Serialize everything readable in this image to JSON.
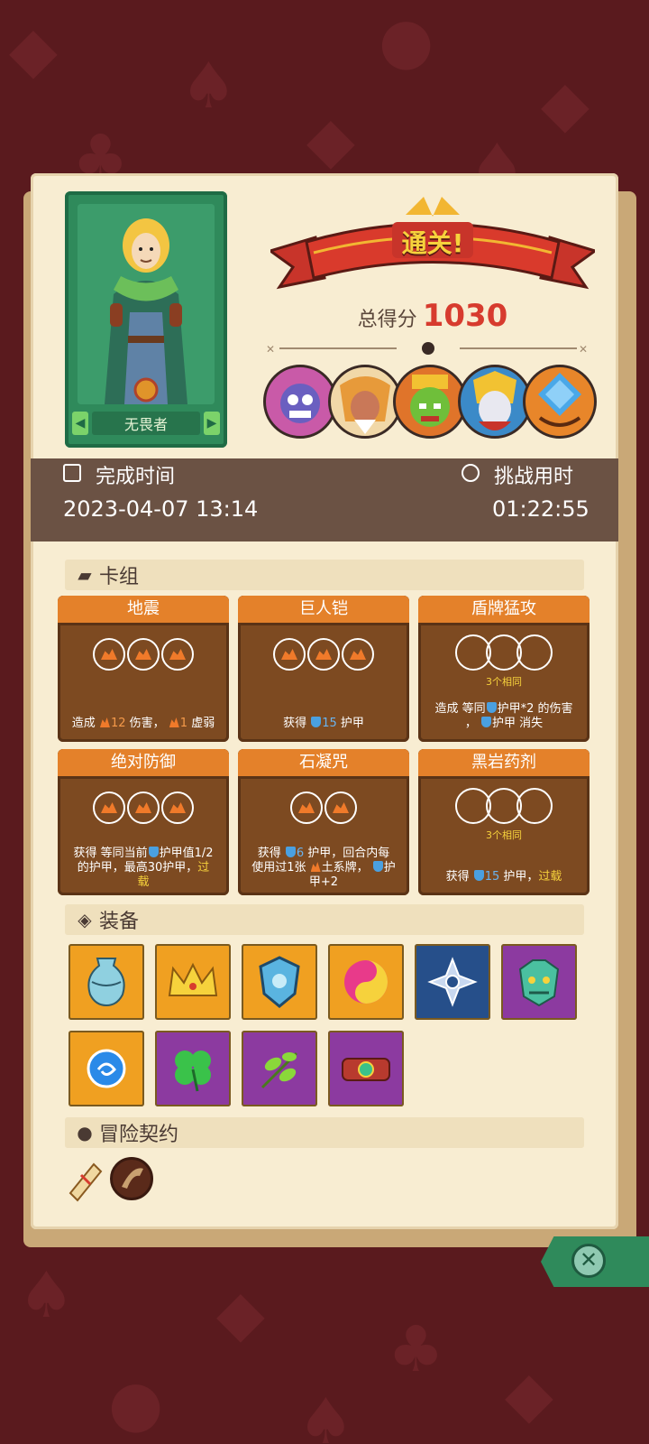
{
  "result": {
    "title": "通关!",
    "score_label": "总得分",
    "score_value": "1030"
  },
  "hero": {
    "name": "无畏者"
  },
  "times": {
    "complete_label": "完成时间",
    "complete_value": "2023-04-07 13:14",
    "challenge_label": "挑战用时",
    "challenge_value": "01:22:55"
  },
  "sections": {
    "deck": "卡组",
    "equipment": "装备",
    "contracts": "冒险契约"
  },
  "cards": [
    {
      "title": "地震"
    },
    {
      "title": "巨人铠"
    },
    {
      "title": "盾牌猛攻",
      "same": "3个相同"
    },
    {
      "title": "绝对防御"
    },
    {
      "title": "石凝咒"
    },
    {
      "title": "黑岩药剂",
      "same": "3个相同"
    }
  ],
  "card_text": {
    "c1_a": "造成",
    "c1_dmg": "12",
    "c1_b": "伤害，",
    "c1_weak": "1",
    "c1_c": "虚弱",
    "c2_a": "获得",
    "c2_armor": "15",
    "c2_b": "护甲",
    "c3_a": "造成 等同",
    "c3_b": "护甲*2 的伤害",
    "c3_c": "，",
    "c3_d": "护甲 消失",
    "c4_a": "获得 等同当前",
    "c4_b": "护甲值1/2",
    "c4_c": "的护甲，最高30护甲，",
    "c4_over1": "过",
    "c4_over2": "载",
    "c5_a": "获得",
    "c5_armor": "6",
    "c5_b": "护甲，回合内每",
    "c5_c": "使用过1张",
    "c5_d": "土系牌，",
    "c5_e": "护",
    "c5_f": "甲+2",
    "c6_a": "获得",
    "c6_armor": "15",
    "c6_b": "护甲，",
    "c6_over": "过载"
  },
  "equipment_icons": [
    "vase-icon",
    "crown-icon",
    "shield-gem-icon",
    "swirl-orb-icon",
    "compass-star-icon",
    "demon-mask-icon",
    "water-orb-icon",
    "four-leaf-clover-icon",
    "leaf-sprig-icon",
    "belt-icon"
  ],
  "contract_icons": [
    "scroll-icon",
    "horn-icon"
  ],
  "colors": {
    "accent": "#e4812a",
    "score": "#d73b2e",
    "highlight": "#f6d23c"
  }
}
